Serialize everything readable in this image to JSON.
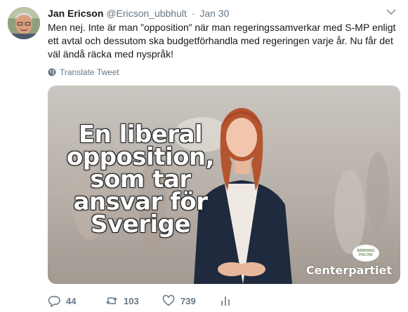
{
  "tweet": {
    "display_name": "Jan Ericson",
    "handle": "@Ericson_ubbhult",
    "separator": "·",
    "date": "Jan 30",
    "text": "Men nej. Inte är man ”opposition” när man regeringssamverkar med S-MP enligt ett avtal och dessutom ska budgetförhandla med regeringen varje år. Nu får det väl ändå räcka med nyspråk!",
    "translate_label": "Translate Tweet"
  },
  "media": {
    "slogan_lines": [
      "En liberal",
      "opposition,",
      "som tar",
      "ansvar för",
      "Sverige"
    ],
    "brand": "Centerpartiet",
    "badge_lines": [
      "BÄRKRAS",
      "POLITIK"
    ]
  },
  "actions": {
    "reply_count": "44",
    "retweet_count": "103",
    "like_count": "739"
  },
  "icons": {
    "avatar": "profile-photo",
    "caret": "chevron-down-icon",
    "translate": "globe-icon",
    "reply": "reply-icon",
    "retweet": "retweet-icon",
    "like": "heart-icon",
    "analytics": "analytics-icon"
  },
  "colors": {
    "secondary_text": "#657786",
    "primary_text": "#14171a"
  }
}
